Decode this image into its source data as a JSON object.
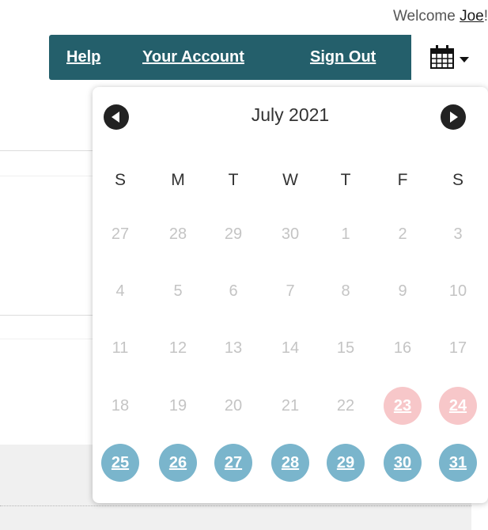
{
  "header": {
    "welcome_prefix": "Welcome ",
    "welcome_user": "Joe",
    "welcome_suffix": "!"
  },
  "nav": {
    "help": "Help",
    "account": "Your Account",
    "signout": "Sign Out",
    "nav_color": "#245f6b",
    "calendar_icon": "calendar-icon"
  },
  "calendar": {
    "month_label": "July 2021",
    "weekdays": [
      "S",
      "M",
      "T",
      "W",
      "T",
      "F",
      "S"
    ],
    "weeks": [
      [
        {
          "day": "27",
          "state": "muted"
        },
        {
          "day": "28",
          "state": "muted"
        },
        {
          "day": "29",
          "state": "muted"
        },
        {
          "day": "30",
          "state": "muted"
        },
        {
          "day": "1",
          "state": "muted"
        },
        {
          "day": "2",
          "state": "muted"
        },
        {
          "day": "3",
          "state": "muted"
        }
      ],
      [
        {
          "day": "4",
          "state": "muted"
        },
        {
          "day": "5",
          "state": "muted"
        },
        {
          "day": "6",
          "state": "muted"
        },
        {
          "day": "7",
          "state": "muted"
        },
        {
          "day": "8",
          "state": "muted"
        },
        {
          "day": "9",
          "state": "muted"
        },
        {
          "day": "10",
          "state": "muted"
        }
      ],
      [
        {
          "day": "11",
          "state": "muted"
        },
        {
          "day": "12",
          "state": "muted"
        },
        {
          "day": "13",
          "state": "muted"
        },
        {
          "day": "14",
          "state": "muted"
        },
        {
          "day": "15",
          "state": "muted"
        },
        {
          "day": "16",
          "state": "muted"
        },
        {
          "day": "17",
          "state": "muted"
        }
      ],
      [
        {
          "day": "18",
          "state": "muted"
        },
        {
          "day": "19",
          "state": "muted"
        },
        {
          "day": "20",
          "state": "muted"
        },
        {
          "day": "21",
          "state": "muted"
        },
        {
          "day": "22",
          "state": "muted"
        },
        {
          "day": "23",
          "state": "pink"
        },
        {
          "day": "24",
          "state": "pink"
        }
      ],
      [
        {
          "day": "25",
          "state": "blue"
        },
        {
          "day": "26",
          "state": "blue"
        },
        {
          "day": "27",
          "state": "blue"
        },
        {
          "day": "28",
          "state": "blue"
        },
        {
          "day": "29",
          "state": "blue"
        },
        {
          "day": "30",
          "state": "blue"
        },
        {
          "day": "31",
          "state": "blue"
        }
      ]
    ],
    "colors": {
      "pink": "#f7c7c9",
      "blue": "#7ab5cc",
      "muted_text": "#c4c4c4"
    }
  }
}
